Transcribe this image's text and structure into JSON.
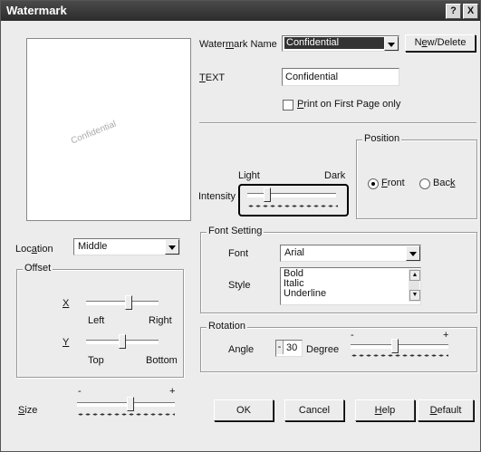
{
  "window": {
    "title": "Watermark",
    "help_btn": "?",
    "close_btn": "X"
  },
  "preview": {
    "watermark_text": "Confidential"
  },
  "watermark_name": {
    "label_pre": "Water",
    "label_acc": "m",
    "label_post": "ark Name",
    "value": "Confidential"
  },
  "new_delete": {
    "pre": "N",
    "acc": "e",
    "post": "w/Delete"
  },
  "text_field": {
    "label_acc": "T",
    "label_post": "EXT",
    "value": "Confidential"
  },
  "first_page": {
    "acc": "P",
    "post": "rint on First Page only",
    "checked": false
  },
  "position": {
    "title": "Position",
    "front_acc": "F",
    "front_post": "ront",
    "back_pre": "Bac",
    "back_acc": "k",
    "back_post": "",
    "selected": "Front"
  },
  "intensity": {
    "label": "Intensity",
    "light": "Light",
    "dark": "Dark",
    "level": 0.25
  },
  "location": {
    "label_pre": "Loc",
    "label_acc": "a",
    "label_post": "tion",
    "value": "Middle"
  },
  "offset": {
    "title": "Offset",
    "x_label": "X",
    "left": "Left",
    "right": "Right",
    "x_level": 0.6,
    "y_label": "Y",
    "top": "Top",
    "bottom": "Bottom",
    "y_level": 0.5
  },
  "font_setting": {
    "title": "Font Setting",
    "font_label": "Font",
    "font_value": "Arial",
    "style_label": "Style",
    "styles": [
      "Bold",
      "Italic",
      "Underline"
    ]
  },
  "rotation": {
    "title": "Rotation",
    "angle_label": "Angle",
    "angle_value": "30",
    "degree": "Degree",
    "level": 0.45
  },
  "size": {
    "label_acc": "S",
    "label_post": "ize",
    "minus": "-",
    "plus": "+",
    "level": 0.55
  },
  "buttons": {
    "ok": "OK",
    "cancel": "Cancel",
    "help_acc": "H",
    "help_post": "elp",
    "default_acc": "D",
    "default_post": "efault"
  }
}
